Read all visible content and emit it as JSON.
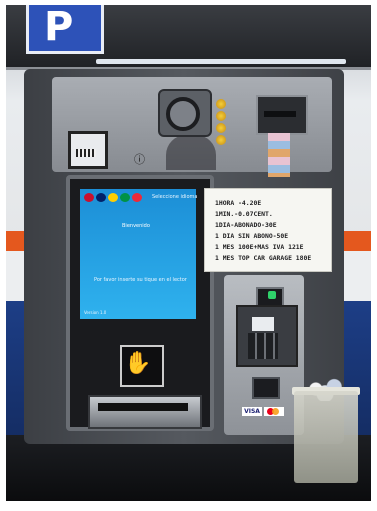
{
  "scene": {
    "sign": {
      "letter": "P"
    },
    "screen": {
      "top_label": "Seleccione idioma",
      "welcome": "Bienvenido",
      "instruction": "Por favor inserte su tique en el lector",
      "footer": "Version 1.0"
    },
    "price_list": [
      "1HORA -4.20E",
      "1MIN.-0.07CENT.",
      "1DIA-ABONADO-30E",
      "1 DIA SIN ABONO-50E",
      "1 MES 100E+MAS IVA 121E",
      "1 MES TOP CAR GARAGE 180E"
    ],
    "payment_logos": {
      "visa": "VISA",
      "mastercard": "mastercard"
    },
    "icons": [
      "parking-sign-icon",
      "coin-slot-icon",
      "banknote-slot-icon",
      "ticket-slot-icon",
      "contactless-icon",
      "info-icon"
    ],
    "colors": {
      "stripe": "#e4581e",
      "wall_blue": "#1d3e86",
      "screen_blue": "#1c8ed6"
    }
  }
}
